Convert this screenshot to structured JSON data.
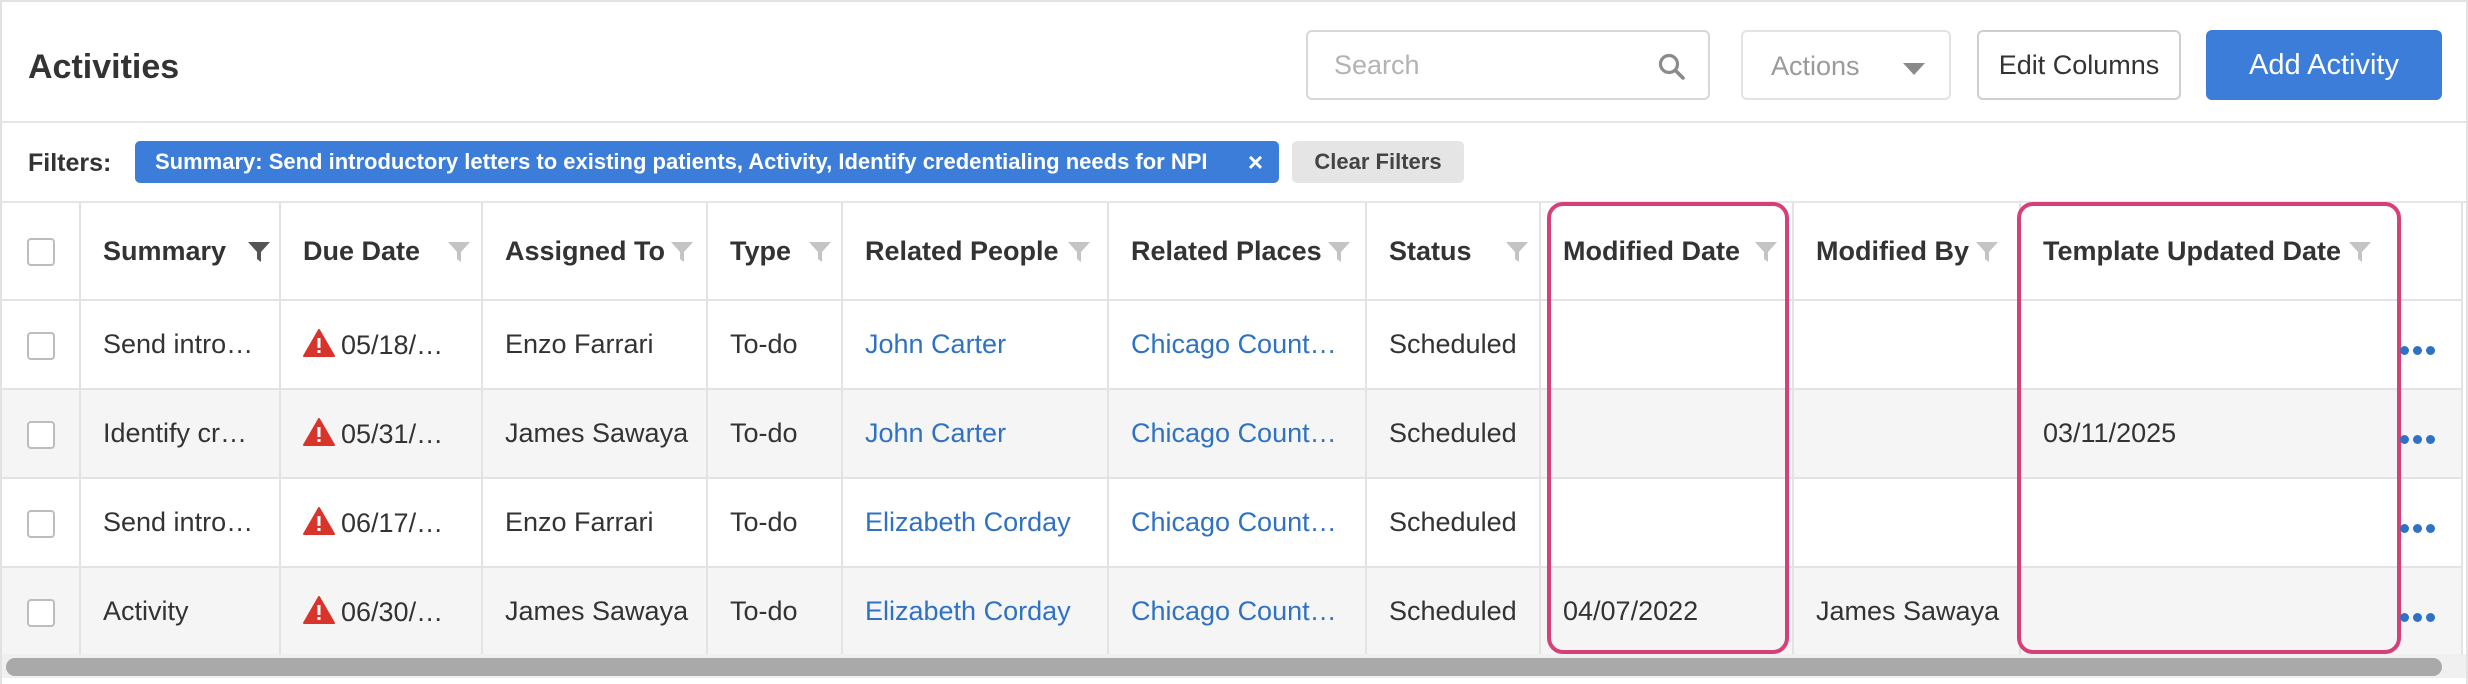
{
  "header": {
    "title": "Activities",
    "search_placeholder": "Search",
    "actions_label": "Actions",
    "edit_columns_label": "Edit Columns",
    "add_activity_label": "Add Activity"
  },
  "filters": {
    "label": "Filters:",
    "chip_text": "Summary: Send introductory letters to existing patients, Activity, Identify credentialing needs for NPI",
    "chip_close": "×",
    "clear_label": "Clear Filters"
  },
  "table": {
    "columns": [
      "Summary",
      "Due Date",
      "Assigned To",
      "Type",
      "Related People",
      "Related Places",
      "Status",
      "Modified Date",
      "Modified By",
      "Template Updated Date"
    ],
    "rows": [
      {
        "summary": "Send intro…",
        "due": "05/18/…",
        "assigned": "Enzo Farrari",
        "type": "To-do",
        "people": "John Carter",
        "places": "Chicago Count…",
        "status": "Scheduled",
        "modified_date": "",
        "modified_by": "",
        "template_date": ""
      },
      {
        "summary": "Identify cr…",
        "due": "05/31/…",
        "assigned": "James Sawaya",
        "type": "To-do",
        "people": "John Carter",
        "places": "Chicago Count…",
        "status": "Scheduled",
        "modified_date": "",
        "modified_by": "",
        "template_date": "03/11/2025"
      },
      {
        "summary": "Send intro…",
        "due": "06/17/…",
        "assigned": "Enzo Farrari",
        "type": "To-do",
        "people": "Elizabeth Corday",
        "places": "Chicago Count…",
        "status": "Scheduled",
        "modified_date": "",
        "modified_by": "",
        "template_date": ""
      },
      {
        "summary": "Activity",
        "due": "06/30/…",
        "assigned": "James Sawaya",
        "type": "To-do",
        "people": "Elizabeth Corday",
        "places": "Chicago Count…",
        "status": "Scheduled",
        "modified_date": "04/07/2022",
        "modified_by": "James Sawaya",
        "template_date": ""
      }
    ]
  },
  "icons": {
    "search": "search-icon",
    "caret": "chevron-down-icon",
    "filter": "filter-icon",
    "warning": "warning-icon",
    "more": "more-options-icon"
  },
  "colors": {
    "accent": "#3b7dd8",
    "link": "#2f72c4",
    "warning": "#d9342b",
    "highlight": "#d6407a"
  }
}
